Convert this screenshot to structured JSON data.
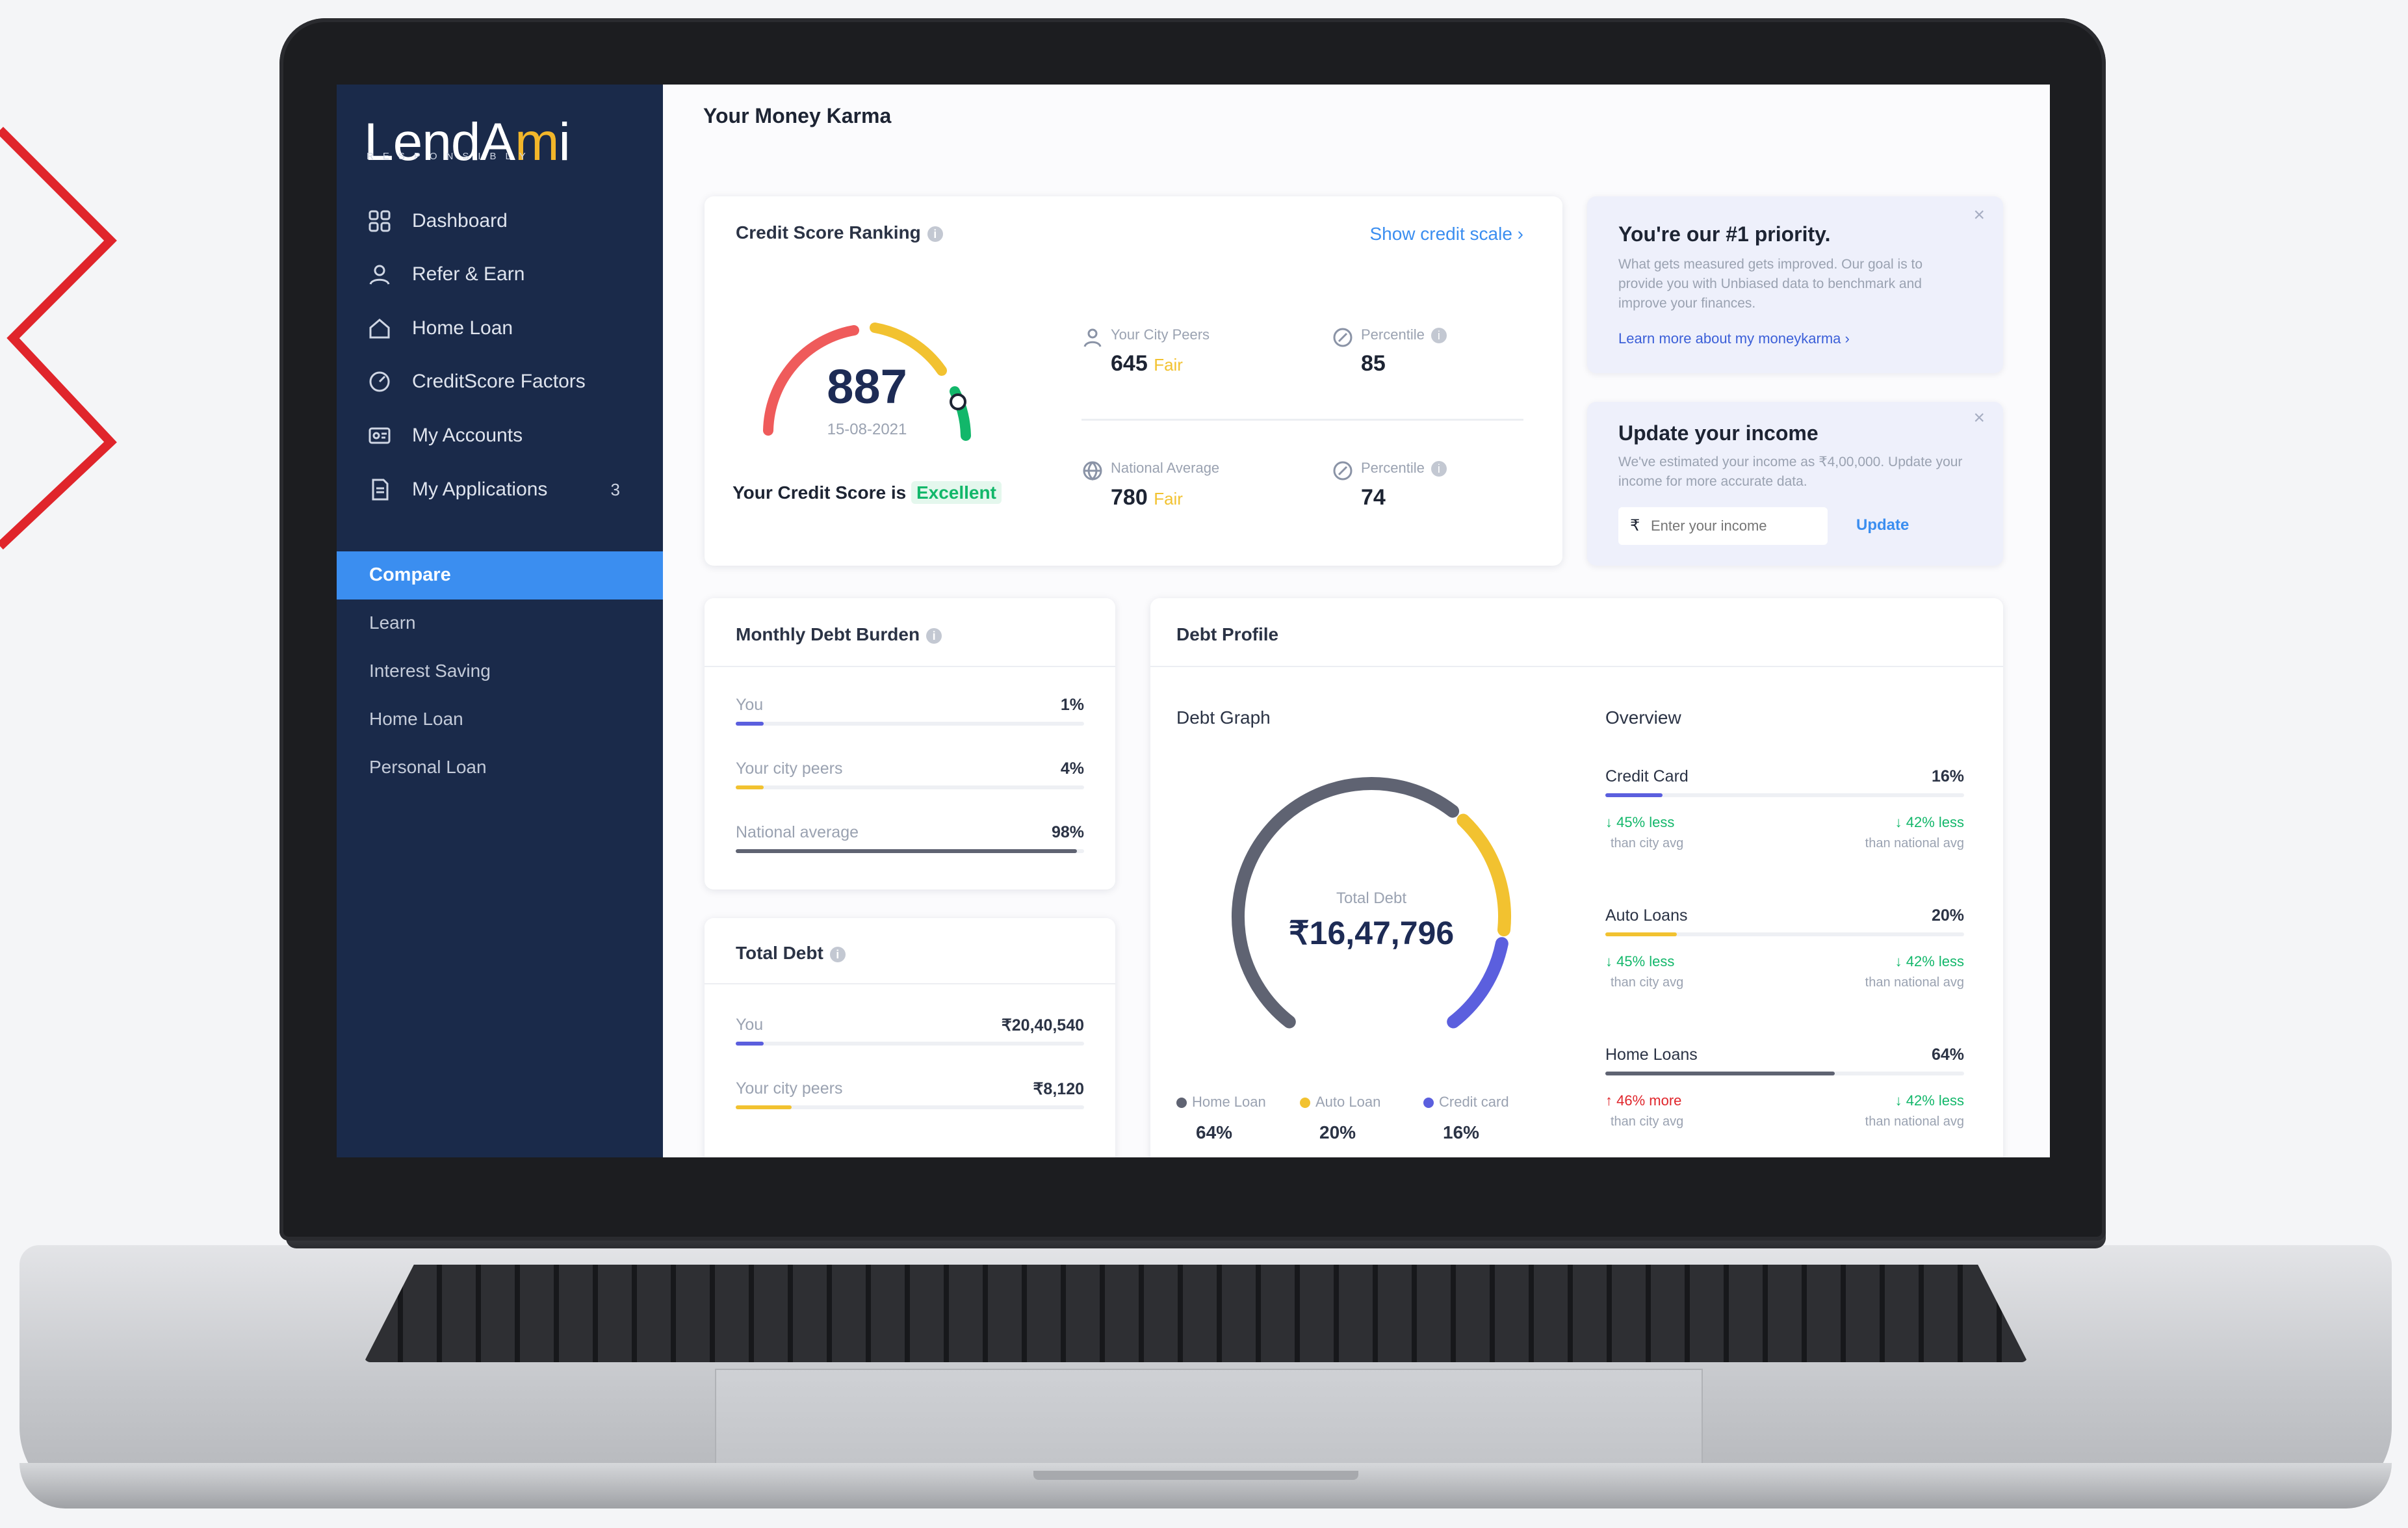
{
  "app": {
    "logo_main": "LendA",
    "logo_accent": "m",
    "logo_end": "i",
    "logo_tagline": "RESPONSIBLY"
  },
  "sidebar": {
    "items": [
      {
        "label": "Dashboard",
        "icon": "grid-icon"
      },
      {
        "label": "Refer & Earn",
        "icon": "user-icon"
      },
      {
        "label": "Home Loan",
        "icon": "home-icon"
      },
      {
        "label": "CreditScore Factors",
        "icon": "gauge-icon"
      },
      {
        "label": "My Accounts",
        "icon": "accounts-icon"
      },
      {
        "label": "My Applications",
        "icon": "document-icon",
        "count": "3"
      }
    ],
    "compare_label": "Compare",
    "sub_items": [
      "Learn",
      "Interest Saving",
      "Home Loan",
      "Personal Loan"
    ]
  },
  "page": {
    "title": "Your Money Karma"
  },
  "credit_score": {
    "title": "Credit Score Ranking",
    "show_scale": "Show credit scale",
    "score": "887",
    "date": "15-08-2021",
    "status_prefix": "Your Credit Score is",
    "status": "Excellent",
    "city_peers_label": "Your City Peers",
    "city_peers_score": "645",
    "city_peers_rating": "Fair",
    "city_percentile_label": "Percentile",
    "city_percentile": "85",
    "national_label": "National Average",
    "national_score": "780",
    "national_rating": "Fair",
    "national_percentile_label": "Percentile",
    "national_percentile": "74"
  },
  "priority": {
    "title": "You're our #1 priority.",
    "body": "What gets measured gets improved. Our goal is to provide you with Unbiased data to benchmark and improve your finances.",
    "link": "Learn more about my moneykarma"
  },
  "income": {
    "title": "Update your income",
    "body": "We've estimated your income as ₹4,00,000. Update your income for more accurate data.",
    "currency": "₹",
    "placeholder": "Enter your income",
    "button": "Update"
  },
  "monthly_debt": {
    "title": "Monthly Debt Burden",
    "rows": [
      {
        "label": "You",
        "value": "1%",
        "pct": 1,
        "color": "#5b5fde"
      },
      {
        "label": "Your city peers",
        "value": "4%",
        "pct": 4,
        "color": "#f2c230"
      },
      {
        "label": "National average",
        "value": "98%",
        "pct": 98,
        "color": "#5f6372"
      }
    ]
  },
  "total_debt": {
    "title": "Total Debt",
    "rows": [
      {
        "label": "You",
        "value": "₹20,40,540",
        "color": "#5b5fde"
      },
      {
        "label": "Your city peers",
        "value": "₹8,120",
        "color": "#f2c230"
      }
    ]
  },
  "debt_profile": {
    "title": "Debt Profile",
    "graph_title": "Debt Graph",
    "total_label": "Total Debt",
    "total_value": "₹16,47,796",
    "legend": [
      {
        "label": "Home Loan",
        "value": "64%",
        "color": "#5f6372"
      },
      {
        "label": "Auto Loan",
        "value": "20%",
        "color": "#f2c230"
      },
      {
        "label": "Credit card",
        "value": "16%",
        "color": "#5b5fde"
      }
    ],
    "overview_title": "Overview",
    "overview": [
      {
        "label": "Credit Card",
        "value": "16%",
        "pct": 16,
        "color": "#5b5fde",
        "city": "45% less",
        "city_sub": "than city avg",
        "city_dir": "down",
        "national": "42% less",
        "national_sub": "than national avg",
        "national_dir": "down"
      },
      {
        "label": "Auto Loans",
        "value": "20%",
        "pct": 20,
        "color": "#f2c230",
        "city": "45% less",
        "city_sub": "than city avg",
        "city_dir": "down",
        "national": "42% less",
        "national_sub": "than national avg",
        "national_dir": "down"
      },
      {
        "label": "Home Loans",
        "value": "64%",
        "pct": 64,
        "color": "#5f6372",
        "city": "46% more",
        "city_sub": "than city avg",
        "city_dir": "up",
        "national": "42% less",
        "national_sub": "than national avg",
        "national_dir": "down"
      }
    ]
  },
  "colors": {
    "sidebar": "#1a2a4a",
    "accent": "#3b8ef0",
    "excellent": "#12b76a",
    "fair": "#f2c230",
    "brand_red": "#e0252b"
  },
  "chart_data": {
    "type": "pie",
    "categories": [
      "Home Loan",
      "Auto Loan",
      "Credit card"
    ],
    "values": [
      64,
      20,
      16
    ],
    "title": "Debt Graph"
  }
}
